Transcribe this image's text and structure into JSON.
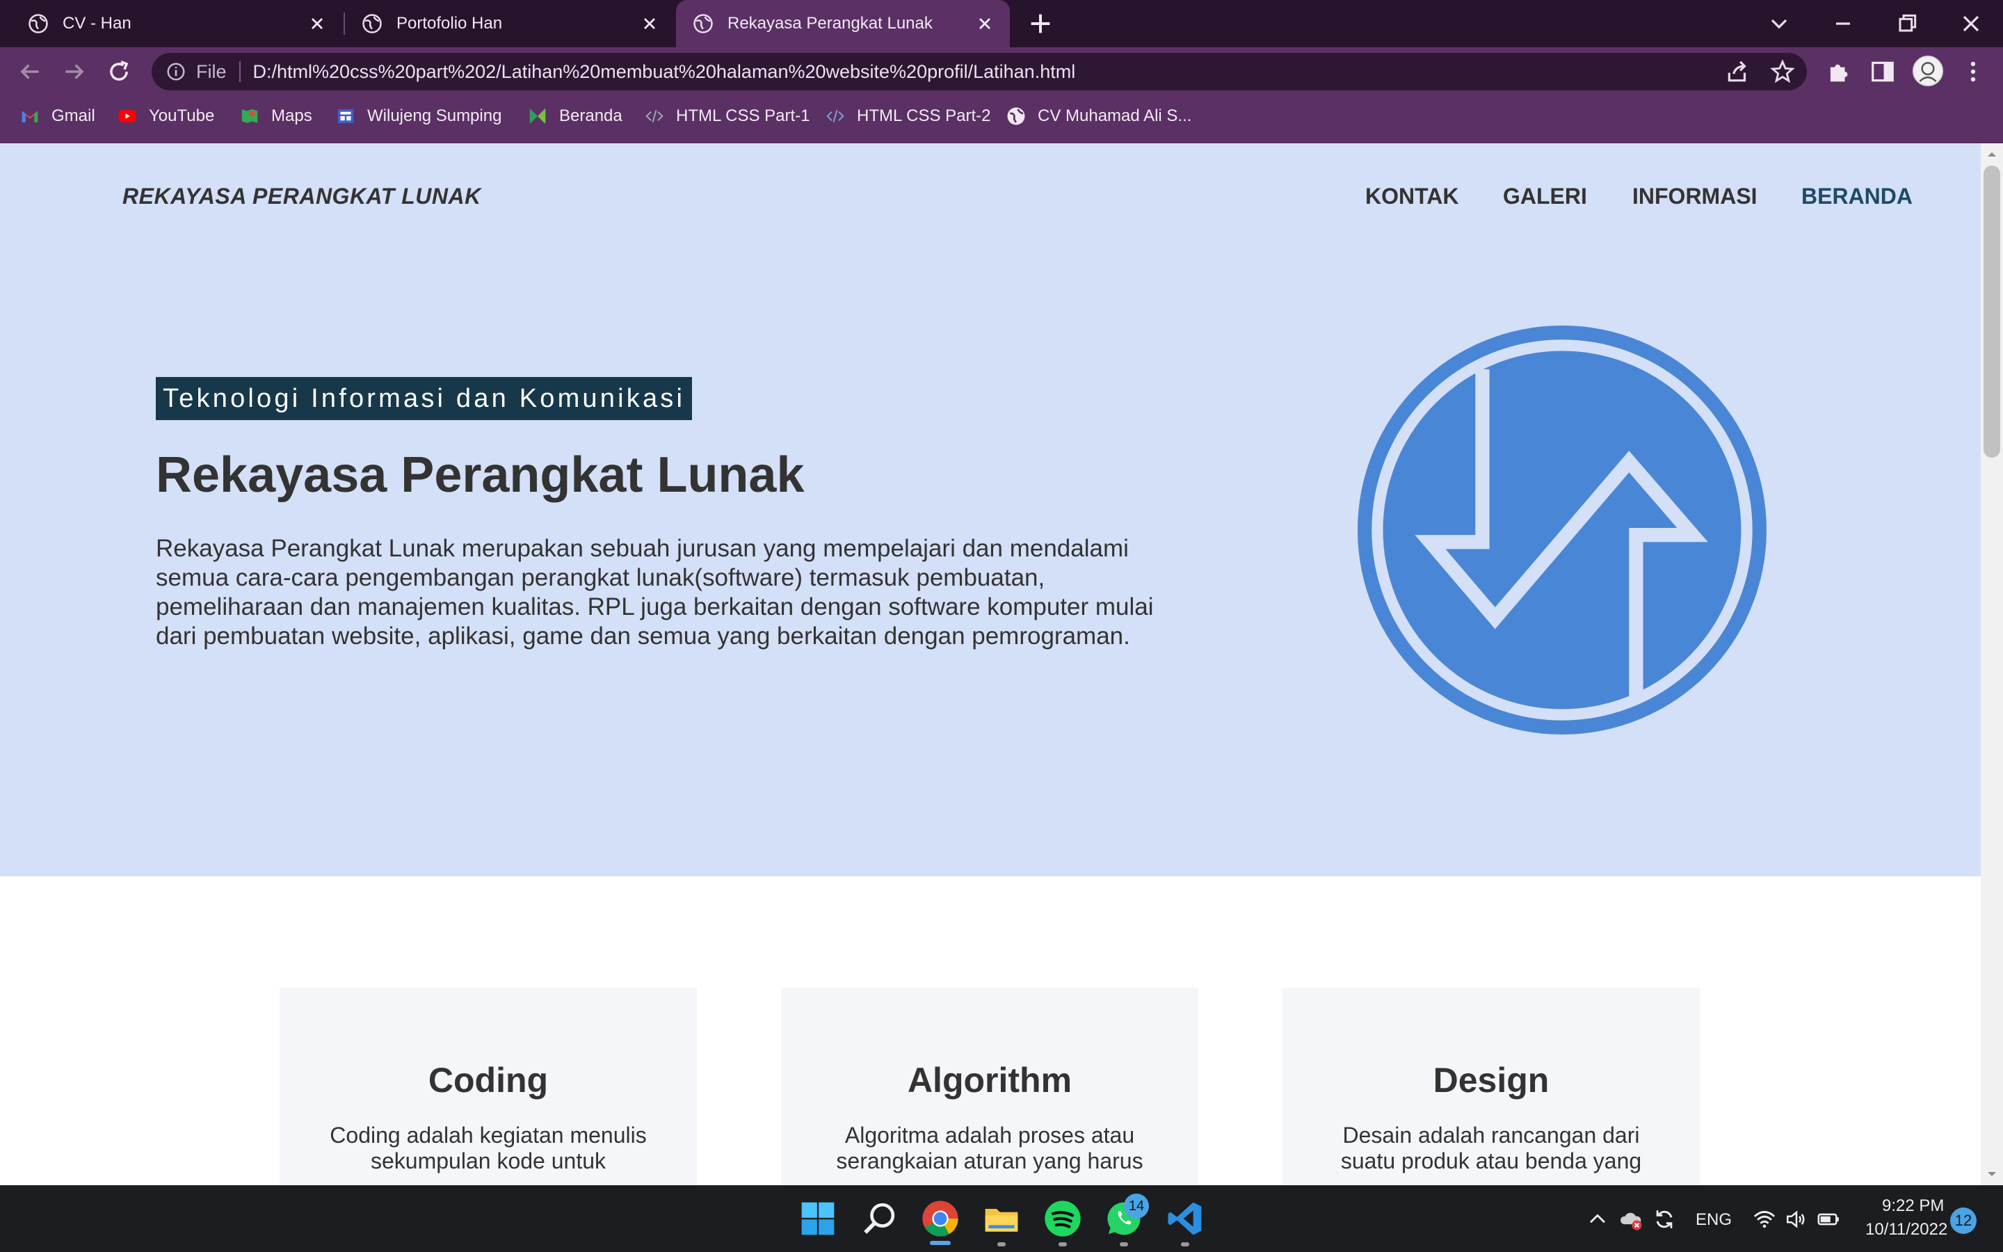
{
  "browser": {
    "tabs": [
      {
        "title": "CV - Han"
      },
      {
        "title": "Portofolio Han"
      },
      {
        "title": "Rekayasa Perangkat Lunak"
      }
    ],
    "address": {
      "scheme": "File",
      "url": "D:/html%20css%20part%202/Latihan%20membuat%20halaman%20website%20profil/Latihan.html"
    },
    "bookmarks": [
      {
        "label": "Gmail",
        "icon": "gmail-icon"
      },
      {
        "label": "YouTube",
        "icon": "youtube-icon"
      },
      {
        "label": "Maps",
        "icon": "maps-icon"
      },
      {
        "label": "Wilujeng Sumping",
        "icon": "site-icon"
      },
      {
        "label": "Beranda",
        "icon": "site-icon"
      },
      {
        "label": "HTML CSS Part-1",
        "icon": "code-icon"
      },
      {
        "label": "HTML CSS Part-2",
        "icon": "code-icon"
      },
      {
        "label": "CV Muhamad Ali S...",
        "icon": "globe-icon"
      }
    ]
  },
  "page": {
    "brand": "REKAYASA PERANGKAT LUNAK",
    "nav": [
      {
        "label": "KONTAK"
      },
      {
        "label": "GALERI"
      },
      {
        "label": "INFORMASI"
      },
      {
        "label": "BERANDA"
      }
    ],
    "hero": {
      "badge": "Teknologi Informasi dan Komunikasi",
      "title": "Rekayasa Perangkat Lunak",
      "description": "Rekayasa Perangkat Lunak merupakan sebuah jurusan yang mempelajari dan mendalami semua cara-cara pengembangan perangkat lunak(software) termasuk pembuatan, pemeliharaan dan manajemen kualitas. RPL juga berkaitan dengan software komputer mulai dari pembuatan website, aplikasi, game dan semua yang berkaitan dengan pemrograman."
    },
    "cards": [
      {
        "title": "Coding",
        "text": "Coding adalah kegiatan menulis sekumpulan kode untuk"
      },
      {
        "title": "Algorithm",
        "text": "Algoritma adalah proses atau serangkaian aturan yang harus"
      },
      {
        "title": "Design",
        "text": "Desain adalah rancangan dari suatu produk atau benda yang"
      }
    ]
  },
  "taskbar": {
    "language": "ENG",
    "time": "9:22 PM",
    "date": "10/11/2022",
    "notification_count": "12",
    "whatsapp_badge": "14"
  },
  "colors": {
    "hero_bg": "#d4e0f7",
    "badge_bg": "#17384b",
    "logo_blue": "#4a86d6",
    "browser_frame": "#5b3064"
  }
}
